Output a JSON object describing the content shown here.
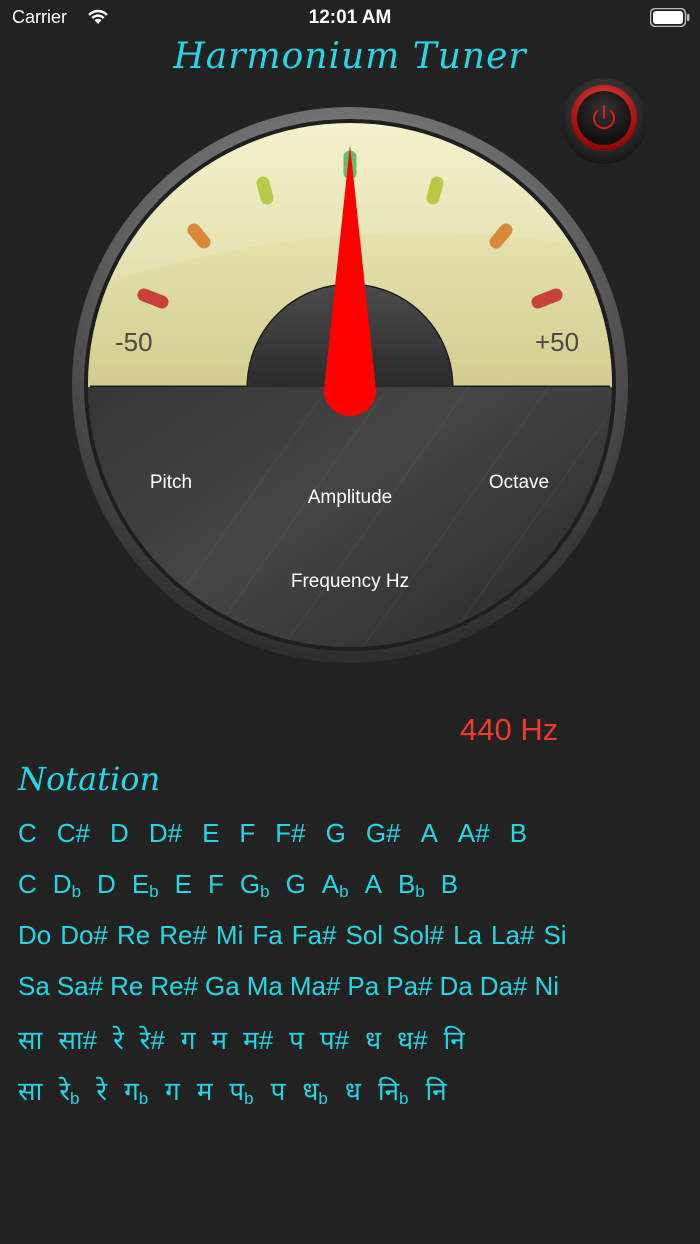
{
  "status_bar": {
    "carrier": "Carrier",
    "time": "12:01 AM"
  },
  "app": {
    "title": "Harmonium Tuner"
  },
  "gauge": {
    "scale_min": "-50",
    "scale_max": "+50",
    "pitch_label": "Pitch",
    "amplitude_label": "Amplitude",
    "octave_label": "Octave",
    "frequency_label": "Frequency Hz",
    "needle_level": 0.5
  },
  "frequency_readout": "440 Hz",
  "notation": {
    "title": "Notation",
    "rows": [
      [
        {
          "t": "C"
        },
        {
          "t": "C#"
        },
        {
          "t": "D"
        },
        {
          "t": "D#"
        },
        {
          "t": "E"
        },
        {
          "t": "F"
        },
        {
          "t": "F#"
        },
        {
          "t": "G"
        },
        {
          "t": "G#"
        },
        {
          "t": "A"
        },
        {
          "t": "A#"
        },
        {
          "t": "B"
        }
      ],
      [
        {
          "t": "C"
        },
        {
          "t": "D",
          "s": "b"
        },
        {
          "t": "D"
        },
        {
          "t": "E",
          "s": "b"
        },
        {
          "t": "E"
        },
        {
          "t": "F"
        },
        {
          "t": "G",
          "s": "b"
        },
        {
          "t": "G"
        },
        {
          "t": "A",
          "s": "b"
        },
        {
          "t": "A"
        },
        {
          "t": "B",
          "s": "b"
        },
        {
          "t": "B"
        }
      ],
      [
        {
          "t": "Do"
        },
        {
          "t": "Do#"
        },
        {
          "t": "Re"
        },
        {
          "t": "Re#"
        },
        {
          "t": "Mi"
        },
        {
          "t": "Fa"
        },
        {
          "t": "Fa#"
        },
        {
          "t": "Sol"
        },
        {
          "t": "Sol#"
        },
        {
          "t": "La"
        },
        {
          "t": "La#"
        },
        {
          "t": "Si"
        }
      ],
      [
        {
          "t": "Sa"
        },
        {
          "t": "Sa#"
        },
        {
          "t": "Re"
        },
        {
          "t": "Re#"
        },
        {
          "t": "Ga"
        },
        {
          "t": "Ma"
        },
        {
          "t": "Ma#"
        },
        {
          "t": "Pa"
        },
        {
          "t": "Pa#"
        },
        {
          "t": "Da"
        },
        {
          "t": "Da#"
        },
        {
          "t": "Ni"
        }
      ],
      [
        {
          "t": "सा"
        },
        {
          "t": "सा#"
        },
        {
          "t": "रे"
        },
        {
          "t": "रे#"
        },
        {
          "t": "ग"
        },
        {
          "t": "म"
        },
        {
          "t": "म#"
        },
        {
          "t": "प"
        },
        {
          "t": "प#"
        },
        {
          "t": "ध"
        },
        {
          "t": "ध#"
        },
        {
          "t": "नि"
        }
      ],
      [
        {
          "t": "सा"
        },
        {
          "t": "रे",
          "s": "b"
        },
        {
          "t": "रे"
        },
        {
          "t": "ग",
          "s": "b"
        },
        {
          "t": "ग"
        },
        {
          "t": "म"
        },
        {
          "t": "प",
          "s": "b"
        },
        {
          "t": "प"
        },
        {
          "t": "ध",
          "s": "b"
        },
        {
          "t": "ध"
        },
        {
          "t": "नि",
          "s": "b"
        },
        {
          "t": "नि"
        }
      ]
    ]
  },
  "colors": {
    "accent": "#22d8e4",
    "readout": "#ef3b2e",
    "needle": "#ff0000",
    "background": "#222222"
  },
  "icons": {
    "power": "power-icon",
    "wifi": "wifi-icon",
    "battery": "battery-icon"
  }
}
